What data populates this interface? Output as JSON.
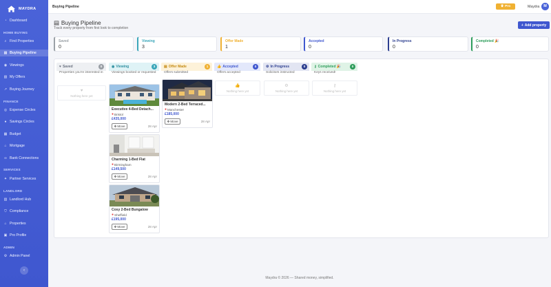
{
  "brand": {
    "name": "MAYDRA"
  },
  "sidebar": {
    "sections": {
      "home_buying": "HOME BUYING",
      "finance": "FINANCE",
      "services": "SERVICES",
      "landlord": "LANDLORD",
      "admin": "ADMIN"
    },
    "items": [
      {
        "label": "Dashboard",
        "icon": "dashboard-icon"
      },
      {
        "label": "Find Properties",
        "icon": "search-icon"
      },
      {
        "label": "Buying Pipeline",
        "icon": "pipeline-icon"
      },
      {
        "label": "Viewings",
        "icon": "eye-icon"
      },
      {
        "label": "My Offers",
        "icon": "offer-icon"
      },
      {
        "label": "Buying Journey",
        "icon": "journey-icon"
      },
      {
        "label": "Expense Circles",
        "icon": "circle-icon"
      },
      {
        "label": "Savings Circles",
        "icon": "piggy-icon"
      },
      {
        "label": "Budget",
        "icon": "budget-icon"
      },
      {
        "label": "Mortgage",
        "icon": "bank-icon"
      },
      {
        "label": "Bank Connections",
        "icon": "link-icon"
      },
      {
        "label": "Partner Services",
        "icon": "handshake-icon"
      },
      {
        "label": "Landlord Hub",
        "icon": "building-icon"
      },
      {
        "label": "Compliance",
        "icon": "shield-icon"
      },
      {
        "label": "Properties",
        "icon": "house-icon"
      },
      {
        "label": "Pro Profile",
        "icon": "id-icon"
      },
      {
        "label": "Admin Panel",
        "icon": "gear-icon"
      }
    ],
    "collapse": "‹"
  },
  "topbar": {
    "breadcrumb": "Buying Pipeline",
    "pro_label": "Pro",
    "user_name": "Maydra",
    "avatar_initial": "M"
  },
  "page": {
    "title": "Buying Pipeline",
    "subtitle": "Track every property from first look to completion",
    "add_button": "Add property"
  },
  "stats": [
    {
      "label": "Saved",
      "value": "0",
      "color": "#9aa0a6"
    },
    {
      "label": "Viewing",
      "value": "3",
      "color": "#3aa6b9"
    },
    {
      "label": "Offer Made",
      "value": "1",
      "color": "#f0b132"
    },
    {
      "label": "Accepted",
      "value": "0",
      "color": "#3f57cf"
    },
    {
      "label": "In Progress",
      "value": "0",
      "color": "#2c3e8f"
    },
    {
      "label": "Completed 🎉",
      "value": "0",
      "color": "#2e9d5b"
    }
  ],
  "columns": [
    {
      "title": "Saved",
      "count": "0",
      "desc": "Properties you're interested in",
      "icon": "heart-icon",
      "bg": "#eef0f3",
      "color": "#6b7280",
      "badge": "#9aa0a6"
    },
    {
      "title": "Viewing",
      "count": "3",
      "desc": "Viewings booked or requested",
      "icon": "eye-icon",
      "bg": "#dff3f6",
      "color": "#2f8fa0",
      "badge": "#3aa6b9"
    },
    {
      "title": "Offer Made",
      "count": "1",
      "desc": "Offers submitted",
      "icon": "document-icon",
      "bg": "#fdf2d9",
      "color": "#c48a12",
      "badge": "#f0b132"
    },
    {
      "title": "Accepted",
      "count": "0",
      "desc": "Offers accepted",
      "icon": "thumbs-up-icon",
      "bg": "#e3e8fb",
      "color": "#3f57cf",
      "badge": "#3f57cf"
    },
    {
      "title": "In Progress",
      "count": "0",
      "desc": "Solicitors instructed",
      "icon": "cogs-icon",
      "bg": "#e2e5f2",
      "color": "#2c3e8f",
      "badge": "#2c3e8f"
    },
    {
      "title": "Completed 🎉",
      "count": "0",
      "desc": "Keys received!",
      "icon": "key-icon",
      "bg": "#dff3e6",
      "color": "#2e9d5b",
      "badge": "#2e9d5b"
    }
  ],
  "empty_text": "Nothing here yet",
  "cards": {
    "viewing": [
      {
        "title": "Executive 4-Bed Detach...",
        "location": "Bristol",
        "price": "£435,000",
        "move": "Move",
        "date": "28 Apr"
      },
      {
        "title": "Charming 1-Bed Flat",
        "location": "Birmingham",
        "price": "£149,500",
        "move": "Move",
        "date": "28 Apr"
      },
      {
        "title": "Cosy 2-Bed Bungalow",
        "location": "Sheffield",
        "price": "£195,000",
        "move": "Move",
        "date": "28 Apr"
      }
    ],
    "offer": [
      {
        "title": "Modern 2-Bed Terraced...",
        "location": "Manchester",
        "price": "£185,000",
        "move": "Move",
        "date": "28 Apr"
      }
    ]
  },
  "footer": "Maydra © 2026 — Shared money, simplified."
}
